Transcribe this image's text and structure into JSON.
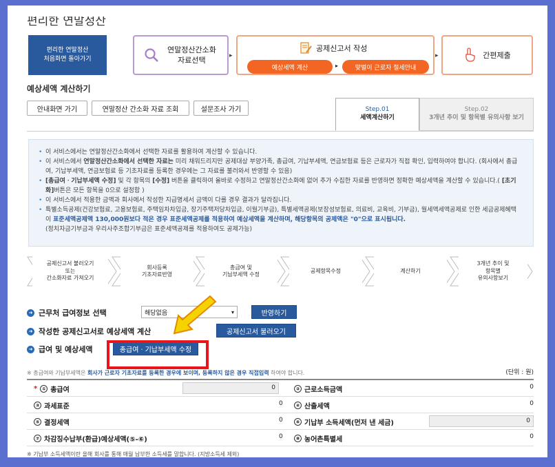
{
  "page": {
    "title": "편리한 연말정산"
  },
  "header": {
    "shortcut_label": "편리한 연말정산\n처음화면 돌아가기",
    "step1_label": "연말정산간소화\n자료선택",
    "step2_title": "공제신고서 작성",
    "step2_pill1": "예상세액 계산",
    "step2_pill2": "맞벌이 근로자 절세안내",
    "step3_label": "간편제출"
  },
  "section": {
    "title": "예상세액 계산하기",
    "buttons": [
      "안내화면 가기",
      "연말정산 간소화 자료 조회",
      "설문조사 가기"
    ],
    "tab1_step": "Step.01",
    "tab1_label": "세액계산하기",
    "tab2_step": "Step.02",
    "tab2_label": "3개년 추이 및 항목별 유의사항 보기"
  },
  "notice": {
    "line1": "이 서비스에서는 연말정산간소화에서 선택한 자료를 활용하여 계산할 수 있습니다.",
    "line2a": "이 서비스에서 ",
    "line2b": "연말정산간소화에서 선택한 자료는",
    "line2c": " 미리 채워드리지만 공제대상 부양가족, 총급여, 기납부세액, 연금보험료 등은 근로자가 직접 확인, 입력하여야 합니다. (회사에서 총급여, 기납부세액, 연금보험료 등 기초자료를 등록한 경우에는 그 자료를 불러와서 반영할 수 있음)",
    "line3a": "[총급여ㆍ기납부세액 수정]",
    "line3b": " 및 각 항목의 ",
    "line3c": "[수정]",
    "line3d": " 버튼을 클릭하여 올바로 수정하고 연말정산간소화에 없어 추가 수집한 자료를 반영하면 정확한 예상세액을 계산할 수 있습니다.( ",
    "line3e": "[초기화]",
    "line3f": "버튼은 모든 항목을 0으로 설정함 )",
    "line4": "이 서비스에서 적용한 금액과 회사에서 작성한 지급명세서 금액이 다를 경우 결과가 달라집니다.",
    "line5a": "특별소득공제(건강보험료, 고용보험료, 주택임차차입금, 장기주택저당차입금, 이월기부금), 특별세액공제(보장성보험료, 의료비, 교육비, 기부금), 월세액세액공제로 인한 세금공제혜택이 ",
    "line5b": "표준세액공제액 130,000원보다 적은 경우 표준세액공제를 적용하여 예상세액을 계산하며, 해당항목의 공제액은 \"0\"으로 표시됩니다.",
    "line5c": "(정치자금기부금과 우리사주조합기부금은 표준세액공제를 적용하여도 공제가능)"
  },
  "flow": [
    "공제신고서 불러오기\n또는\n간소화자료 가져오기",
    "회사등록\n기초자료반영",
    "총급여 및\n기납부세액 수정",
    "공제항목수정",
    "계산하기",
    "3개년 추이 및\n항목별\n유의사항보기"
  ],
  "rows": {
    "row1_label": "근무처 급여정보 선택",
    "select_value": "해당없음",
    "apply_button": "반영하기",
    "row2_label": "작성한 공제신고서로 예상세액 계산",
    "load_button": "공제신고서 불러오기",
    "row3_label": "급여 및 예상세액",
    "edit_button": "총급여ㆍ기납부세액 수정"
  },
  "table": {
    "note_a": "※ 총급여와 기납부세액은 ",
    "note_b": "회사가 근로자 기초자료를 등록한 경우에 보이며, 등록하지 않은 경우 직접입력",
    "note_c": " 하여야 합니다.",
    "unit": "(단위 : 원)",
    "items": [
      {
        "n": "①",
        "label": "총급여",
        "value": "0",
        "req": "*"
      },
      {
        "n": "②",
        "label": "근로소득금액",
        "value": "0"
      },
      {
        "n": "③",
        "label": "과세표준",
        "value": "0"
      },
      {
        "n": "④",
        "label": "산출세액",
        "value": "0"
      },
      {
        "n": "⑤",
        "label": "결정세액",
        "value": "0"
      },
      {
        "n": "⑥",
        "label": "기납부 소득세액(먼저 낸 세금)",
        "value": "0"
      },
      {
        "n": "⑦",
        "label": "차감징수납부(환급)예상세액(⑤-⑥)",
        "value": "0"
      },
      {
        "n": "⑧",
        "label": "농어촌특별세",
        "value": "0"
      }
    ],
    "footnote": "※ 기납부 소득세액이란 올해 회사를 통해 매월 납부한 소득세를 말합니다. (지방소득세 제외)"
  },
  "colors": {
    "brand_blue": "#2a5a9e",
    "accent_orange": "#f26522",
    "highlight_red": "#e8161b",
    "arrow_yellow": "#f5d200"
  },
  "icons": {
    "search": "magnifier-icon",
    "doc": "document-pencil-icon",
    "hand": "pointing-hand-icon"
  }
}
